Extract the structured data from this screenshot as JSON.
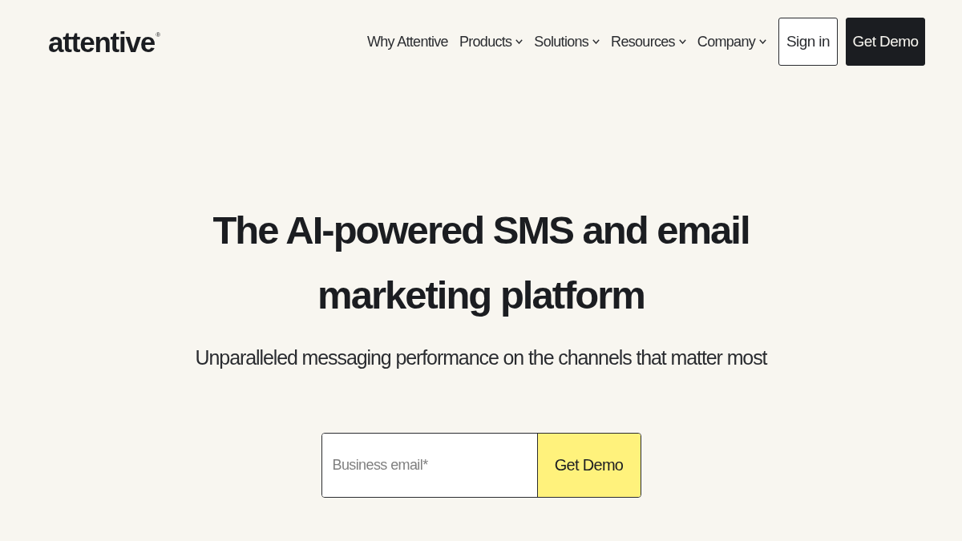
{
  "header": {
    "logo": {
      "text": "attentive",
      "mark": "®"
    },
    "nav": [
      {
        "label": "Why Attentive",
        "kind": "link"
      },
      {
        "label": "Products",
        "kind": "dropdown"
      },
      {
        "label": "Solutions",
        "kind": "dropdown"
      },
      {
        "label": "Resources",
        "kind": "dropdown"
      },
      {
        "label": "Company",
        "kind": "dropdown"
      }
    ],
    "buttons": [
      {
        "label": "Sign in",
        "kind": "outline"
      },
      {
        "label": "Get Demo",
        "kind": "solid"
      }
    ]
  },
  "hero": {
    "title": "The AI-powered SMS and email marketing platform",
    "subtitle": "Unparalleled messaging performance on the channels that matter most",
    "form": {
      "placeholder": "Business email*",
      "button": "Get Demo"
    }
  }
}
